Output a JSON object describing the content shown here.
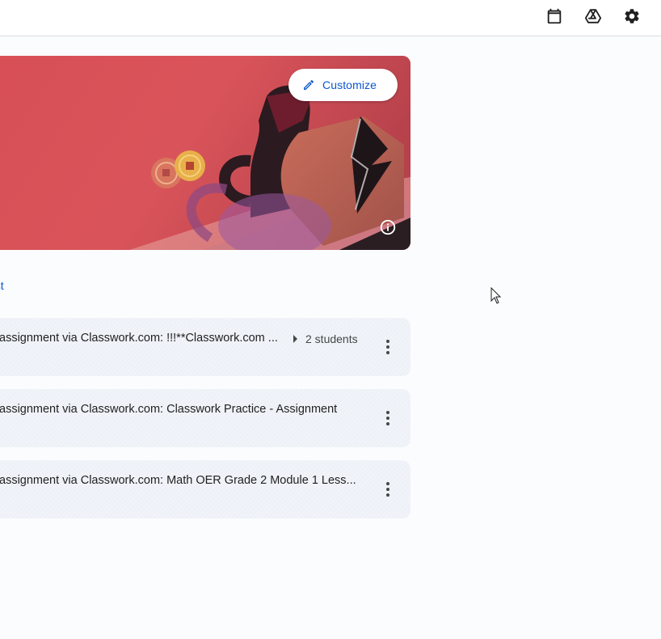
{
  "topbar": {
    "icons": [
      "calendar-icon",
      "drive-icon",
      "settings-icon"
    ]
  },
  "banner": {
    "customize_label": "Customize",
    "colors": {
      "background": "#d9545a",
      "dark": "#2b1a1f",
      "accent": "#0b57d0"
    }
  },
  "stream": {
    "post_link": "ost",
    "cards": [
      {
        "title": "assignment via Classwork.com: !!!**Classwork.com ...",
        "meta": "2 students"
      },
      {
        "title": "assignment via Classwork.com: Classwork Practice - Assignment",
        "meta": ""
      },
      {
        "title": "assignment via Classwork.com: Math OER Grade 2 Module 1 Less...",
        "meta": ""
      }
    ]
  }
}
